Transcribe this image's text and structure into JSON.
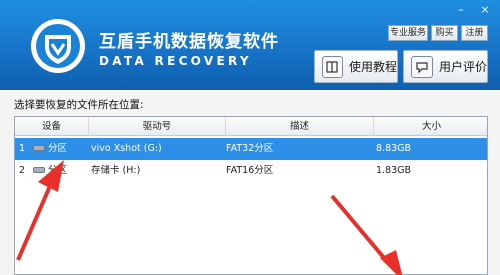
{
  "header": {
    "title": "互盾手机数据恢复软件",
    "subtitle": "DATA RECOVERY",
    "top_buttons": [
      "专业服务",
      "购买",
      "注册"
    ],
    "window_buttons": [
      "–",
      "×"
    ],
    "tutorial_label": "使用教程",
    "review_label": "用户评价"
  },
  "main": {
    "prompt": "选择要恢复的文件所在位置:",
    "columns": [
      "设备",
      "驱动号",
      "描述",
      "大小"
    ],
    "rows": [
      {
        "index": "1",
        "device": "分区",
        "drive": "vivo Xshot (G:)",
        "desc": "FAT32分区",
        "size": "8.83GB",
        "selected": true
      },
      {
        "index": "2",
        "device": "分区",
        "drive": "存储卡 (H:)",
        "desc": "FAT16分区",
        "size": "1.83GB",
        "selected": false
      }
    ]
  },
  "colors": {
    "header_blue": "#1774c8",
    "selection_blue": "#2d8fe8",
    "arrow_red": "#e8302a"
  }
}
